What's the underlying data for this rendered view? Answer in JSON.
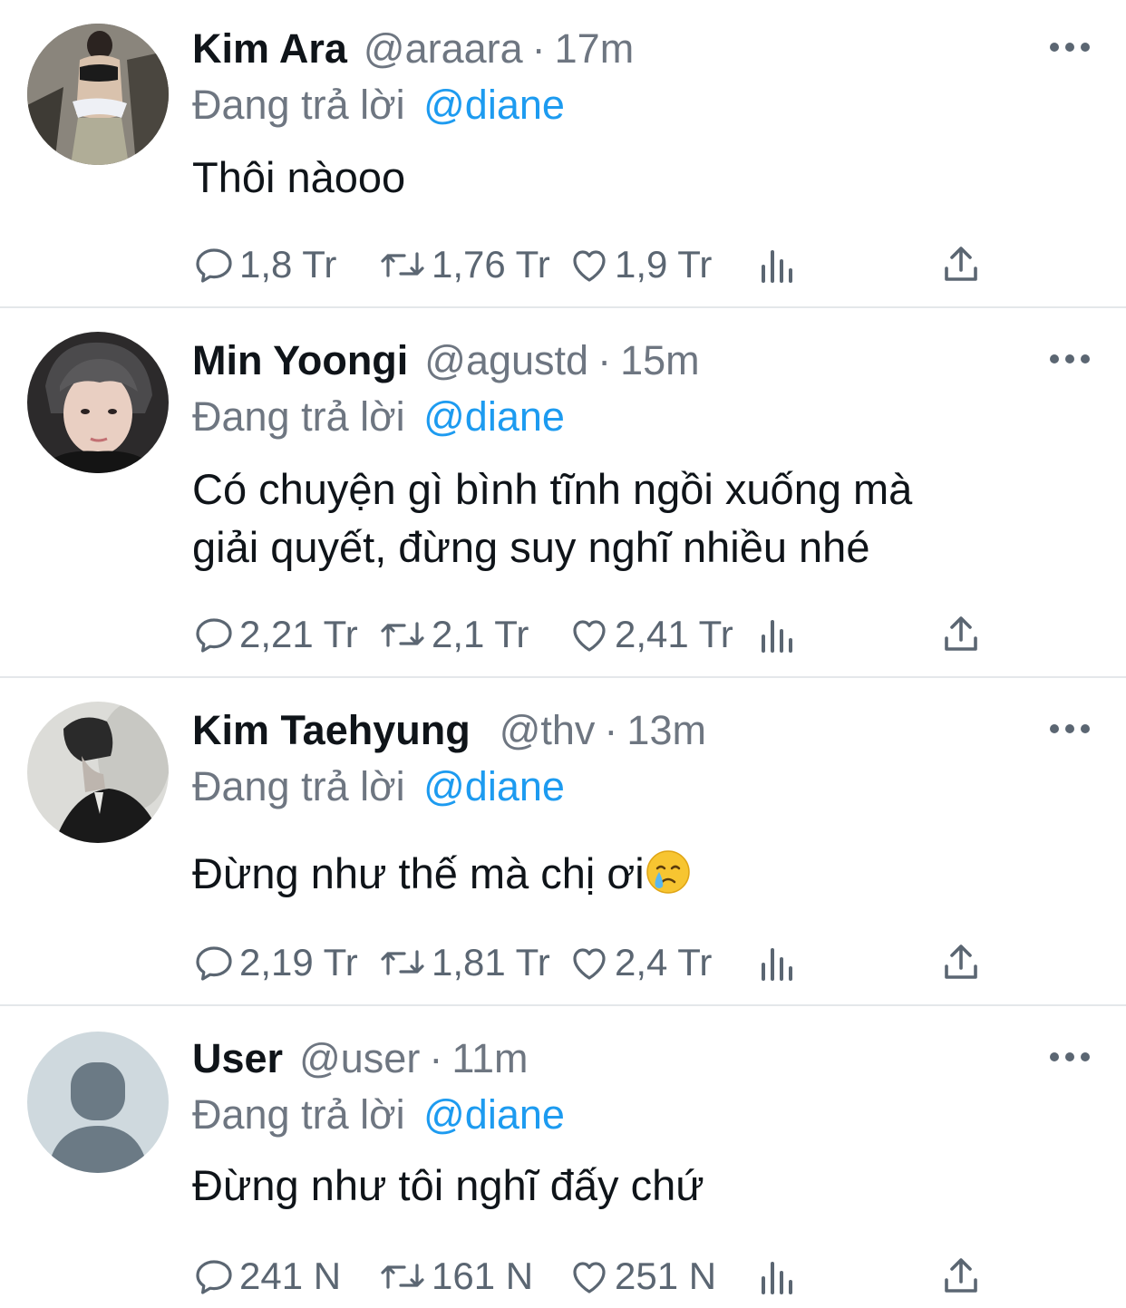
{
  "tweets": [
    {
      "name": "Kim Ara",
      "handle": "@araara",
      "time": "17m",
      "reply_prefix": "Đang trả lời",
      "reply_to": "@diane",
      "text_lines": [
        "Thôi nàooo"
      ],
      "replies": "1,8 Tr",
      "retweets": "1,76 Tr",
      "likes": "1,9 Tr"
    },
    {
      "name": "Min Yoongi",
      "handle": "@agustd",
      "time": "15m",
      "reply_prefix": "Đang trả lời",
      "reply_to": "@diane",
      "text_lines": [
        "Có chuyện gì bình tĩnh ngồi xuống mà",
        "giải quyết, đừng suy nghĩ nhiều nhé"
      ],
      "replies": "2,21 Tr",
      "retweets": "2,1 Tr",
      "likes": "2,41 Tr"
    },
    {
      "name": "Kim Taehyung",
      "handle": "@thv",
      "time": "13m",
      "reply_prefix": "Đang trả lời",
      "reply_to": "@diane",
      "text_lines": [
        "Đừng như thế mà chị ơi"
      ],
      "emoji": "crying-face-emoji",
      "replies": "2,19 Tr",
      "retweets": "1,81 Tr",
      "likes": "2,4 Tr"
    },
    {
      "name": "User",
      "handle": "@user",
      "time": "11m",
      "reply_prefix": "Đang trả lời",
      "reply_to": "@diane",
      "text_lines": [
        "Đừng như tôi nghĩ đấy chứ"
      ],
      "replies": "241 N",
      "retweets": "161 N",
      "likes": "251 N"
    }
  ],
  "colors": {
    "text": "#0f1419",
    "secondary": "#6e7681",
    "mention": "#1d9bf0",
    "divider": "#e4e7ea",
    "icon": "#5b6672"
  },
  "icons": [
    "reply-icon",
    "retweet-icon",
    "like-icon",
    "analytics-icon",
    "share-icon",
    "more-icon"
  ]
}
